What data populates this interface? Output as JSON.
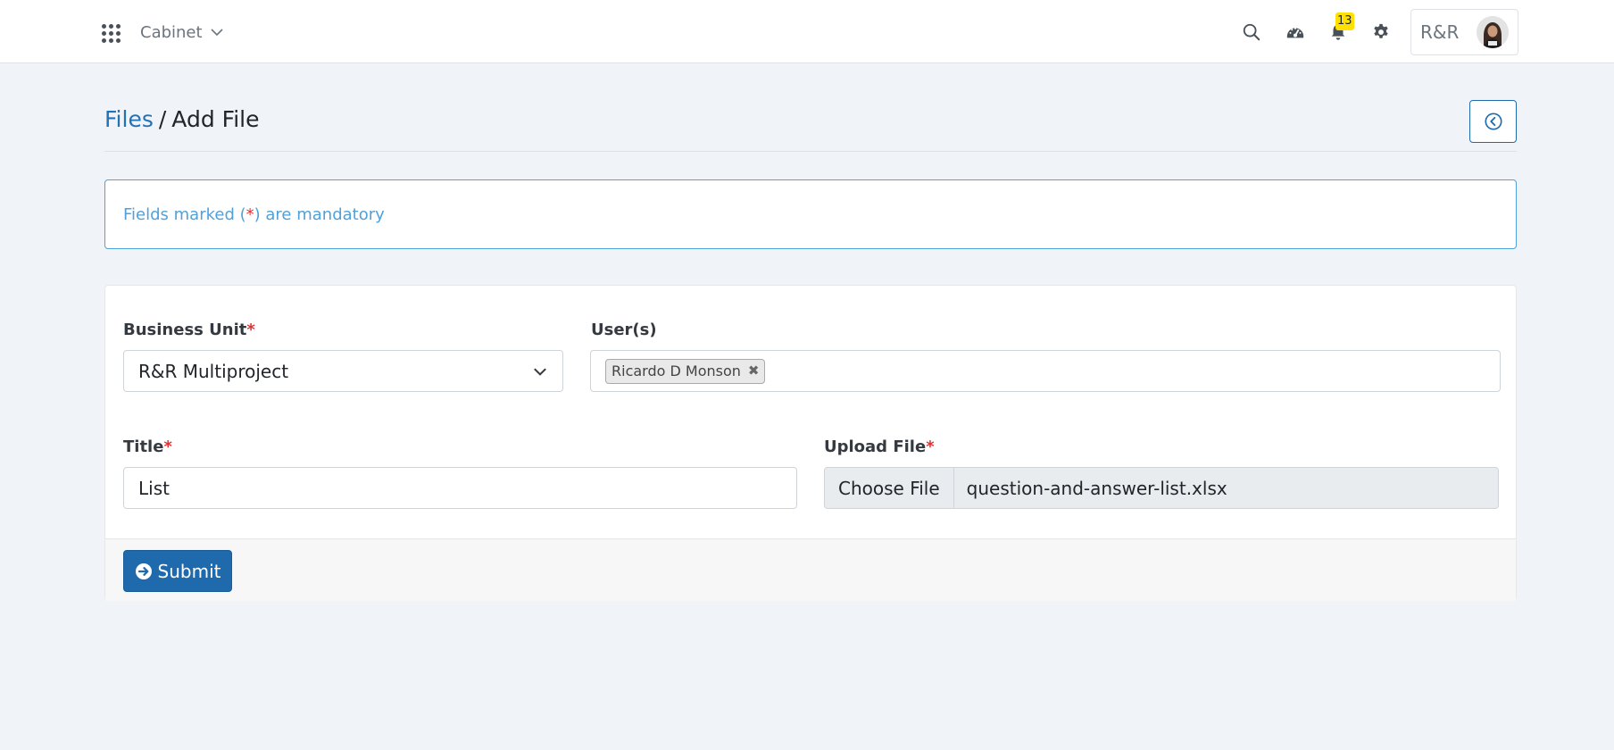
{
  "navbar": {
    "apps_icon": "grid-dots-icon",
    "module": "Cabinet",
    "icons": [
      "search-icon",
      "dashboard-gauge-icon",
      "bell-icon",
      "gear-icon"
    ],
    "notification_count": "13",
    "org_label": "R&R",
    "badge_color": "#ffe000"
  },
  "breadcrumb": {
    "parent": "Files",
    "separator": "/",
    "current": "Add File"
  },
  "alert": {
    "prefix": "Fields marked (",
    "asterisk": "*",
    "suffix": ") are mandatory"
  },
  "form": {
    "business_unit": {
      "label": "Business Unit",
      "required_mark": "*",
      "value": "R&R Multiproject"
    },
    "users": {
      "label": "User(s)",
      "tags": [
        "Ricardo D Monson"
      ],
      "remove_glyph": "✖"
    },
    "title": {
      "label": "Title",
      "required_mark": "*",
      "value": "List"
    },
    "upload": {
      "label": "Upload File",
      "required_mark": "*",
      "button_label": "Choose File",
      "file_name": "question-and-answer-list.xlsx"
    },
    "submit_label": "Submit"
  },
  "colors": {
    "primary": "#1f6aad",
    "link": "#2272b6",
    "info": "#4fa1db",
    "required": "#e03131",
    "background": "#f0f3f8"
  }
}
